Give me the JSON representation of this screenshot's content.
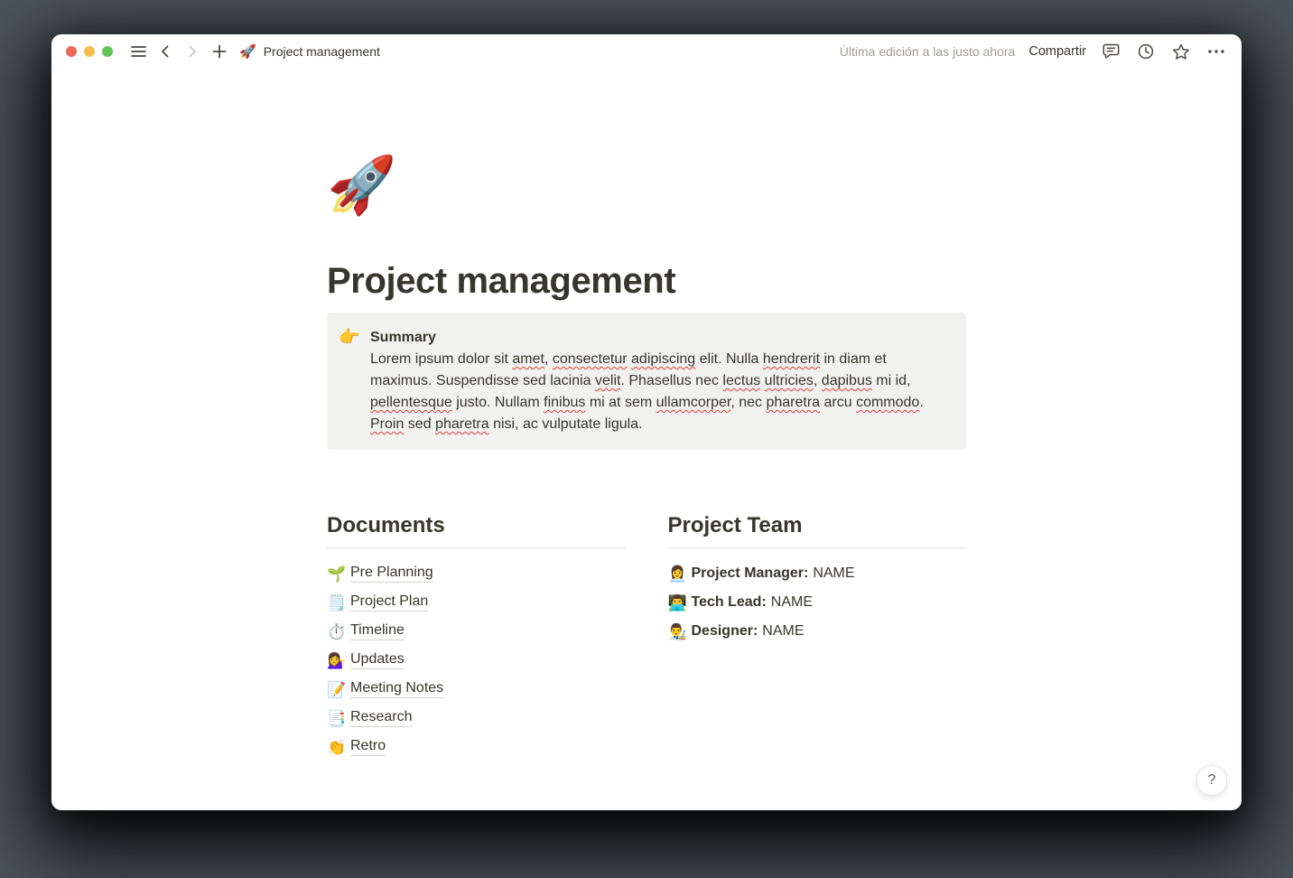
{
  "colors": {
    "desktop_bg": "#4C555C",
    "window_bg": "#FFFFFF",
    "text": "#37352F",
    "muted_text": "#A09D98",
    "icon": "#4A4843",
    "disabled_icon": "#C8C6C2",
    "callout_bg": "#F1F1EF",
    "divider": "#DEDDDA",
    "link_underline": "#D3D1CB",
    "squiggle": "#E03E3E",
    "traffic_red": "#ED6A5E",
    "traffic_yellow": "#F5BF4F",
    "traffic_green": "#61C454"
  },
  "titlebar": {
    "page_icon": "🚀",
    "page_title": "Project management",
    "last_edited": "Última edición a las justo ahora",
    "share_label": "Compartir"
  },
  "page": {
    "icon": "🚀",
    "title": "Project management",
    "callout": {
      "icon": "👉",
      "heading": "Summary",
      "segments": [
        {
          "text": "Lorem ipsum dolor sit "
        },
        {
          "text": "amet",
          "misspelled": true
        },
        {
          "text": ", "
        },
        {
          "text": "consectetur",
          "misspelled": true
        },
        {
          "text": " "
        },
        {
          "text": "adipiscing",
          "misspelled": true
        },
        {
          "text": " elit. Nulla "
        },
        {
          "text": "hendrerit",
          "misspelled": true
        },
        {
          "text": " in diam et maximus. Suspendisse sed lacinia "
        },
        {
          "text": "velit",
          "misspelled": true
        },
        {
          "text": ". Phasellus nec "
        },
        {
          "text": "lectus",
          "misspelled": true
        },
        {
          "text": " "
        },
        {
          "text": "ultricies",
          "misspelled": true
        },
        {
          "text": ", "
        },
        {
          "text": "dapibus",
          "misspelled": true
        },
        {
          "text": " mi id, "
        },
        {
          "text": "pellentesque",
          "misspelled": true
        },
        {
          "text": " justo. Nullam "
        },
        {
          "text": "finibus",
          "misspelled": true
        },
        {
          "text": " mi at sem "
        },
        {
          "text": "ullamcorper",
          "misspelled": true
        },
        {
          "text": ", nec "
        },
        {
          "text": "pharetra",
          "misspelled": true
        },
        {
          "text": " arcu "
        },
        {
          "text": "commodo",
          "misspelled": true
        },
        {
          "text": ". "
        },
        {
          "text": "Proin",
          "misspelled": true
        },
        {
          "text": " sed "
        },
        {
          "text": "pharetra",
          "misspelled": true
        },
        {
          "text": " nisi, ac vulputate ligula."
        }
      ]
    },
    "documents": {
      "heading": "Documents",
      "items": [
        {
          "icon": "🌱",
          "icon_name": "seedling-icon",
          "label": "Pre Planning"
        },
        {
          "icon": "🗒️",
          "icon_name": "spiral-notepad-icon",
          "label": "Project Plan"
        },
        {
          "icon": "⏱️",
          "icon_name": "stopwatch-icon",
          "label": "Timeline"
        },
        {
          "icon": "💁‍♀️",
          "icon_name": "person-tipping-hand-icon",
          "label": "Updates"
        },
        {
          "icon": "📝",
          "icon_name": "memo-icon",
          "label": "Meeting Notes"
        },
        {
          "icon": "📑",
          "icon_name": "bookmark-tabs-icon",
          "label": "Research"
        },
        {
          "icon": "👏",
          "icon_name": "clapping-hands-icon",
          "label": "Retro"
        }
      ]
    },
    "team": {
      "heading": "Project Team",
      "items": [
        {
          "icon": "👩‍💼",
          "icon_name": "woman-office-worker-icon",
          "role": "Project Manager:",
          "value": "NAME"
        },
        {
          "icon": "👨‍💻",
          "icon_name": "man-technologist-icon",
          "role": "Tech Lead:",
          "value": "NAME"
        },
        {
          "icon": "👨‍🎨",
          "icon_name": "man-artist-icon",
          "role": "Designer:",
          "value": "NAME"
        }
      ]
    },
    "help_label": "?"
  }
}
